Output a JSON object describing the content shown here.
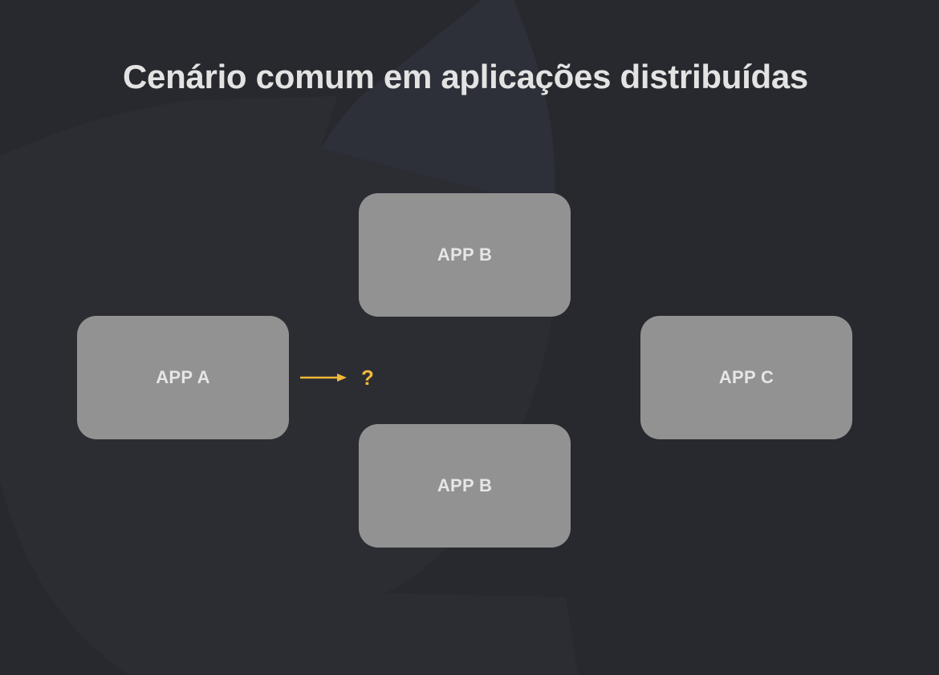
{
  "slide": {
    "title": "Cenário comum em aplicações distribuídas"
  },
  "diagram": {
    "nodes": {
      "app_a": "APP A",
      "app_b_top": "APP B",
      "app_b_bottom": "APP B",
      "app_c": "APP C"
    },
    "unknown_target_label": "?"
  },
  "colors": {
    "background": "#27292e",
    "box_fill": "#929292",
    "box_text": "#e6e6e6",
    "title_text": "#e3e3e3",
    "accent": "#f2b83a"
  },
  "icons": {
    "connector": "right-arrow-icon"
  }
}
